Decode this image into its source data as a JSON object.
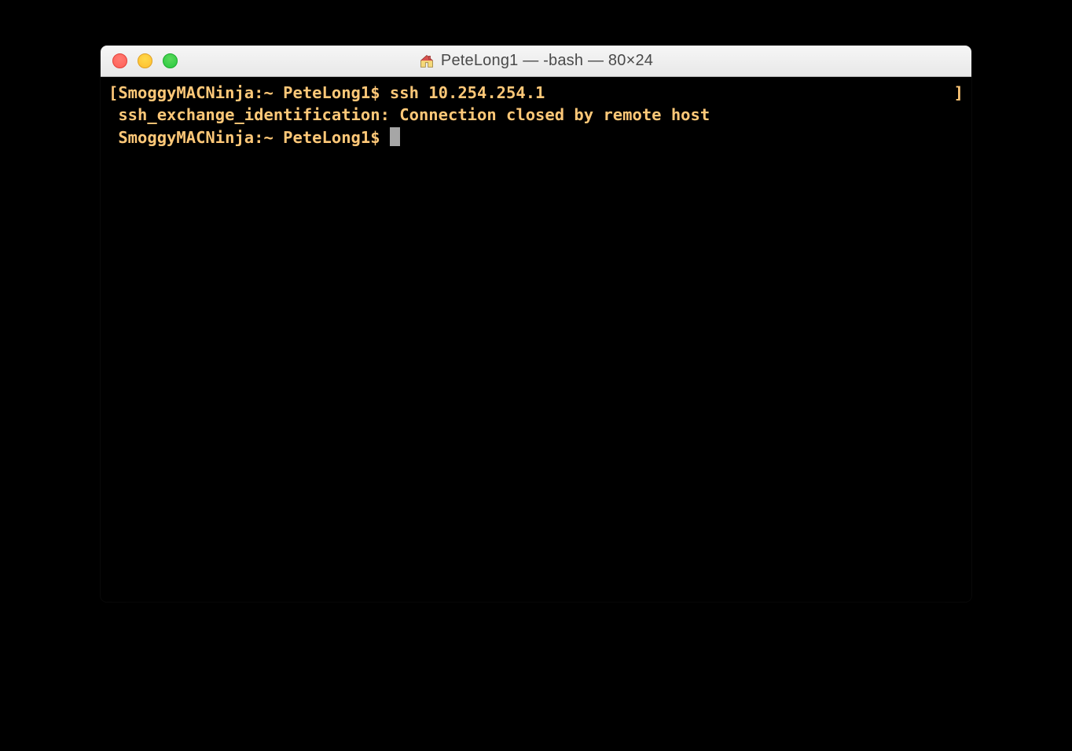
{
  "window": {
    "title": "PeteLong1 — -bash — 80×24"
  },
  "terminal": {
    "bracket_left": "[",
    "bracket_right": "]",
    "line1_prompt": "SmoggyMACNinja:~ PeteLong1$ ",
    "line1_command": "ssh 10.254.254.1",
    "line2": "ssh_exchange_identification: Connection closed by remote host",
    "line3_prompt": "SmoggyMACNinja:~ PeteLong1$ "
  }
}
